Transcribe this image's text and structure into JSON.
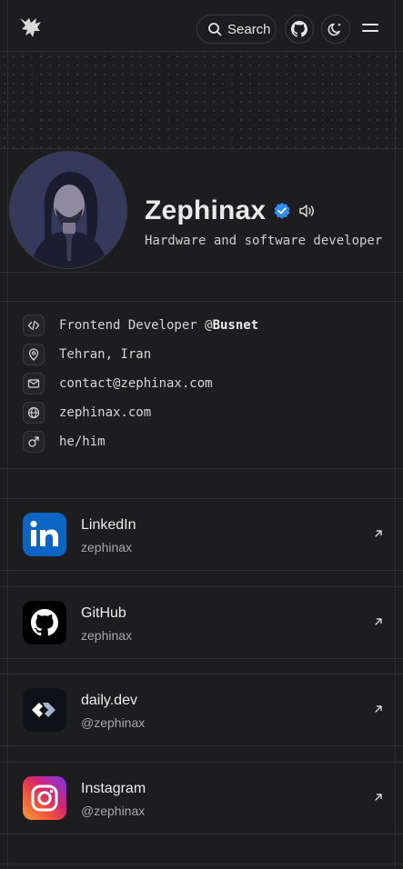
{
  "header": {
    "search_label": "Search"
  },
  "profile": {
    "name": "Zephinax",
    "tagline": "Hardware and software developer"
  },
  "info": [
    {
      "icon": "code-icon",
      "prefix": "Frontend Developer @",
      "strong": "Busnet"
    },
    {
      "icon": "location-pin-icon",
      "prefix": "Tehran, Iran",
      "strong": ""
    },
    {
      "icon": "mail-icon",
      "prefix": "contact@zephinax.com",
      "strong": ""
    },
    {
      "icon": "globe-icon",
      "prefix": "zephinax.com",
      "strong": ""
    },
    {
      "icon": "male-icon",
      "prefix": "he/him",
      "strong": ""
    }
  ],
  "socials": [
    {
      "title": "LinkedIn",
      "handle": "zephinax"
    },
    {
      "title": "GitHub",
      "handle": "zephinax"
    },
    {
      "title": "daily.dev",
      "handle": "@zephinax"
    },
    {
      "title": "Instagram",
      "handle": "@zephinax"
    }
  ],
  "colors": {
    "background": "#1d1d1f",
    "verified": "#2f8cf0",
    "linkedin": "#0a66c2",
    "github": "#000000",
    "dailydev": "#0e1217"
  }
}
